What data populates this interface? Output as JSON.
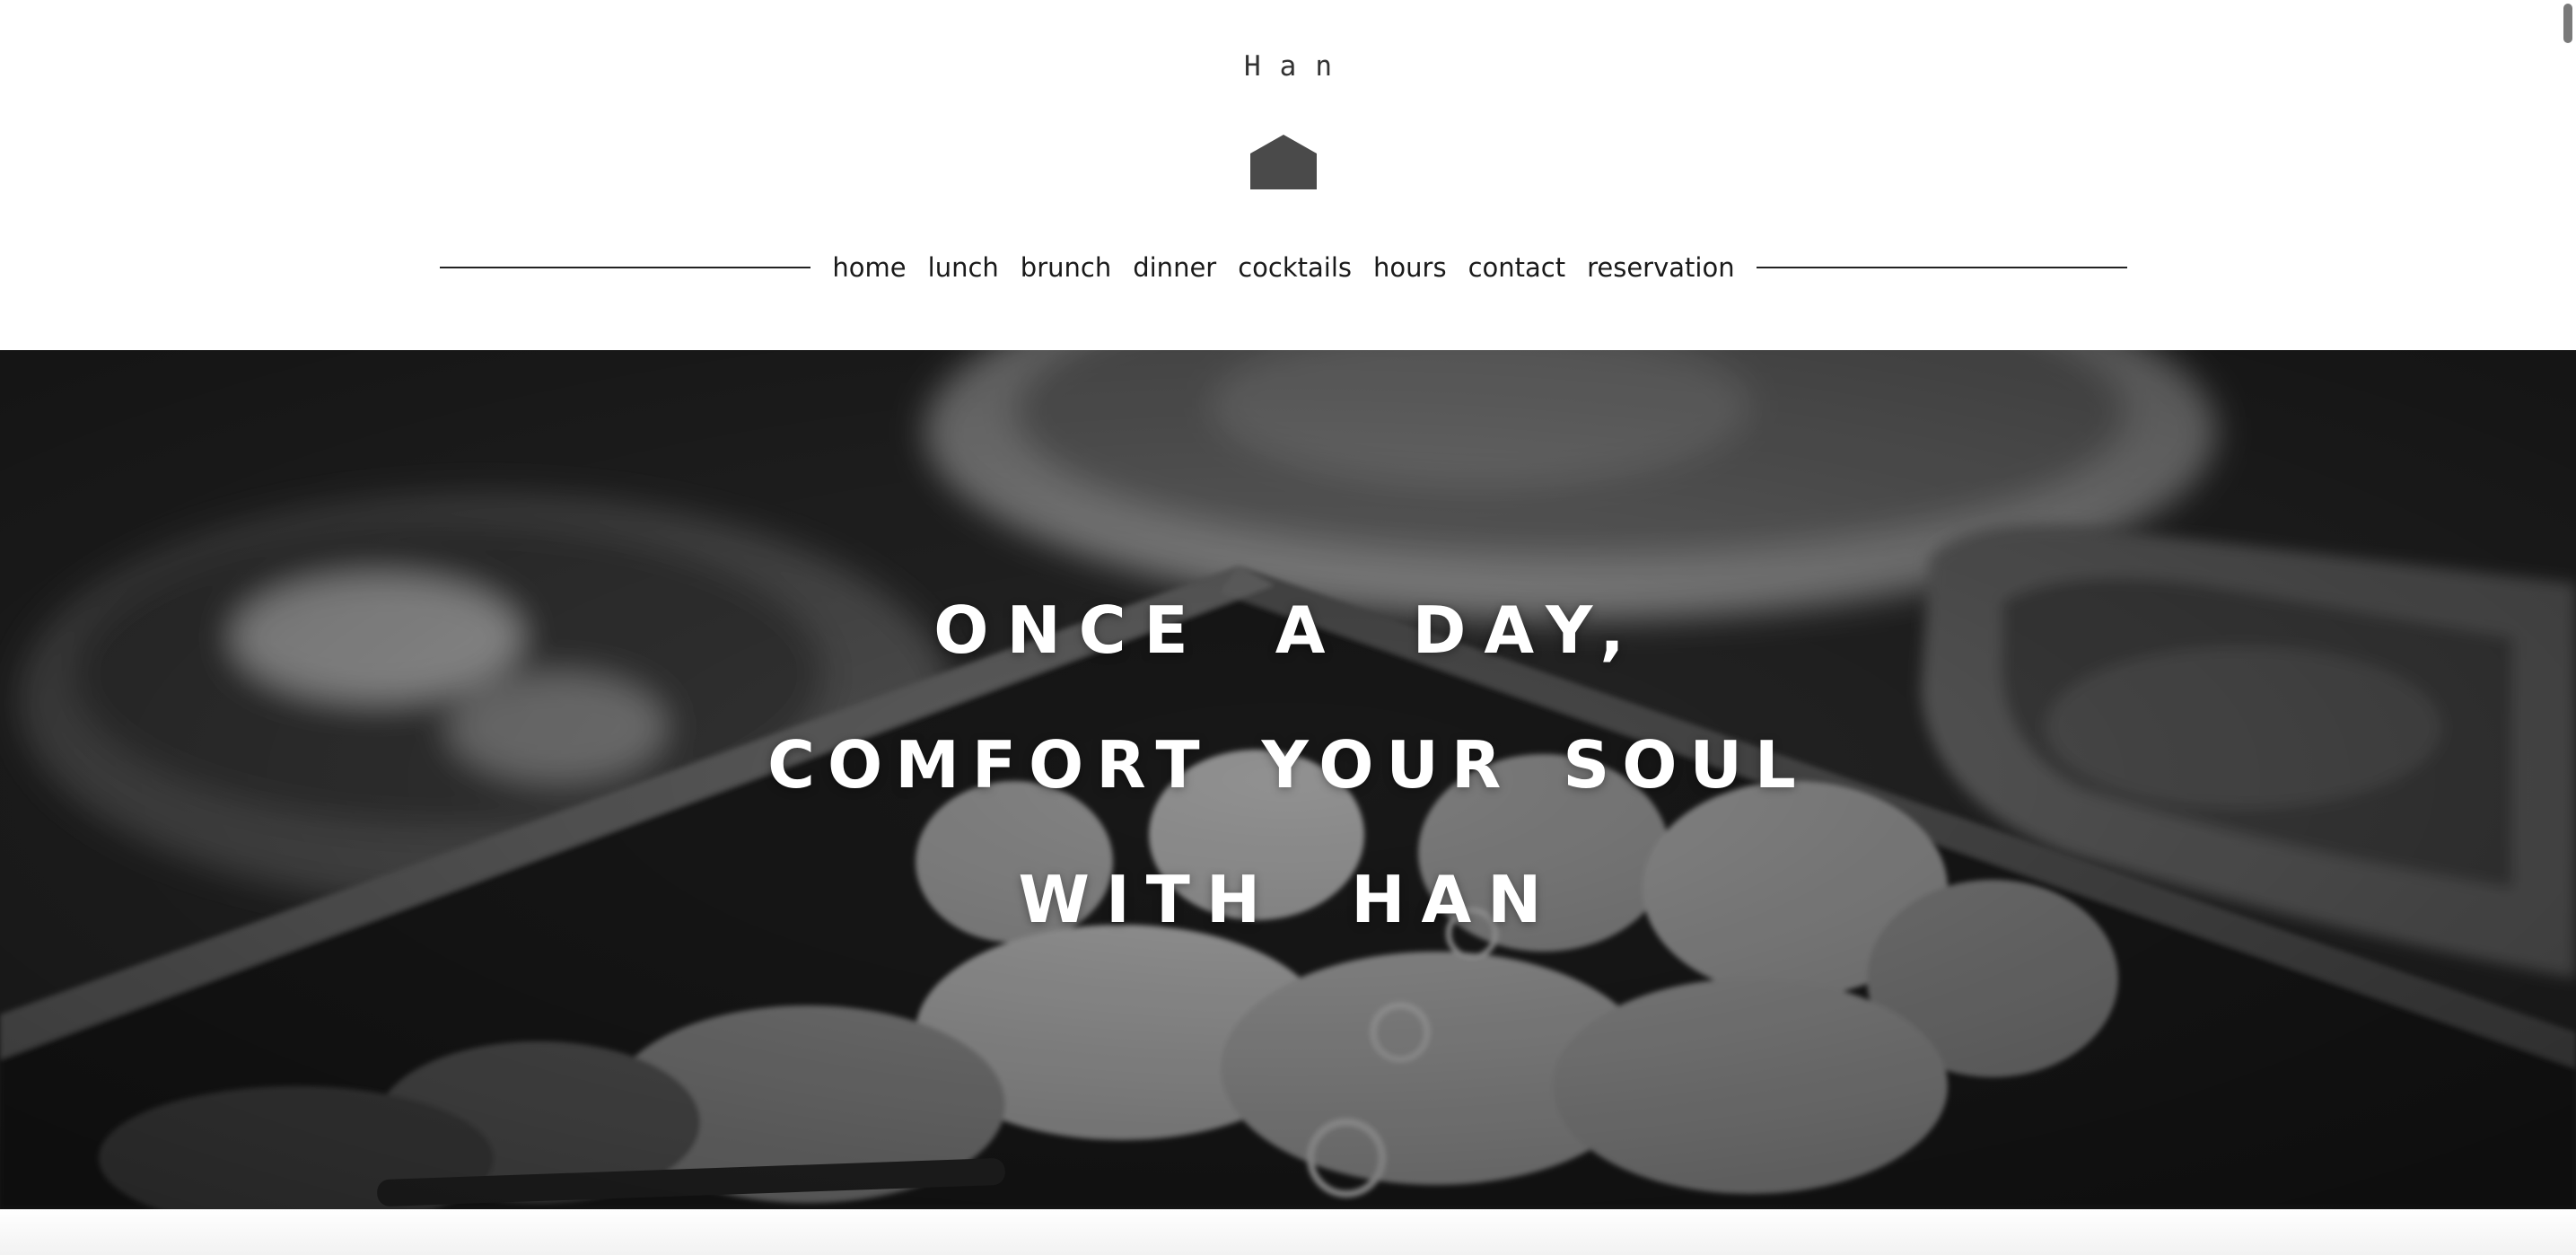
{
  "header": {
    "brand": "Han",
    "home_icon": "house-icon",
    "nav": [
      {
        "label": "home"
      },
      {
        "label": "lunch"
      },
      {
        "label": "brunch"
      },
      {
        "label": "dinner"
      },
      {
        "label": "cocktails"
      },
      {
        "label": "hours"
      },
      {
        "label": "contact"
      },
      {
        "label": "reservation"
      }
    ]
  },
  "hero": {
    "line1": "ONCE A DAY,",
    "line2": "COMFORT YOUR SOUL",
    "line3": "WITH HAN",
    "image": "grayscale-food-photo"
  },
  "colors": {
    "text": "#1a1a1a",
    "icon": "#4a4a4a",
    "hero_text": "#ffffff"
  }
}
